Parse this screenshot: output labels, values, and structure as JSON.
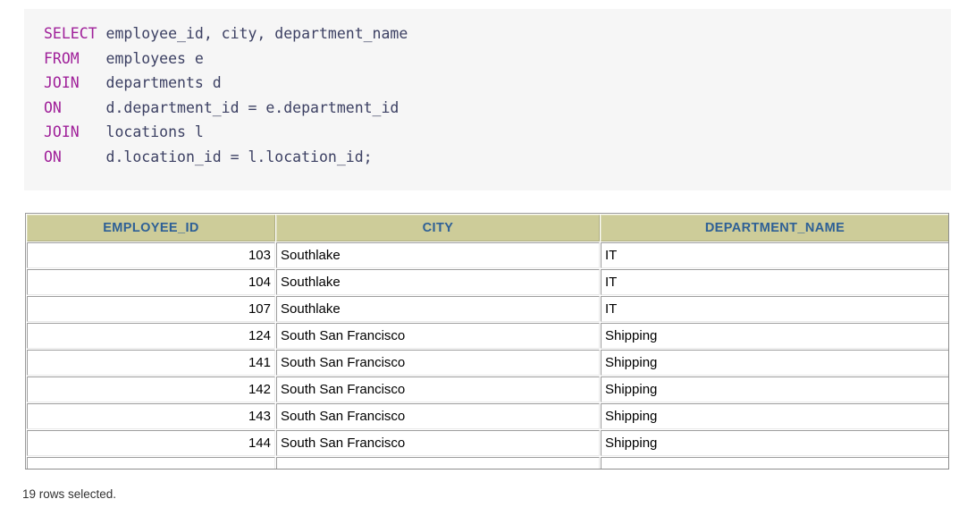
{
  "sql": {
    "lines": [
      {
        "keyword": "SELECT",
        "rest": " employee_id, city, department_name"
      },
      {
        "keyword": "FROM",
        "rest": "   employees e"
      },
      {
        "keyword": "JOIN",
        "rest": "   departments d"
      },
      {
        "keyword": "ON",
        "rest": "     d.department_id = e.department_id"
      },
      {
        "keyword": "JOIN",
        "rest": "   locations l"
      },
      {
        "keyword": "ON",
        "rest": "     d.location_id = l.location_id;"
      }
    ],
    "keyword_color": "#a0219a",
    "identifier_color": "#3c4063",
    "background_color": "#f6f6f6"
  },
  "result_grid": {
    "columns": [
      "EMPLOYEE_ID",
      "CITY",
      "DEPARTMENT_NAME"
    ],
    "header_background": "#cdcc99",
    "header_text_color": "#2e6096",
    "rows": [
      [
        "103",
        "Southlake",
        "IT"
      ],
      [
        "104",
        "Southlake",
        "IT"
      ],
      [
        "107",
        "Southlake",
        "IT"
      ],
      [
        "124",
        "South San Francisco",
        "Shipping"
      ],
      [
        "141",
        "South San Francisco",
        "Shipping"
      ],
      [
        "142",
        "South San Francisco",
        "Shipping"
      ],
      [
        "143",
        "South San Francisco",
        "Shipping"
      ],
      [
        "144",
        "South San Francisco",
        "Shipping"
      ],
      [
        "",
        "",
        ""
      ]
    ]
  },
  "footer": {
    "rows_selected": "19 rows selected."
  }
}
